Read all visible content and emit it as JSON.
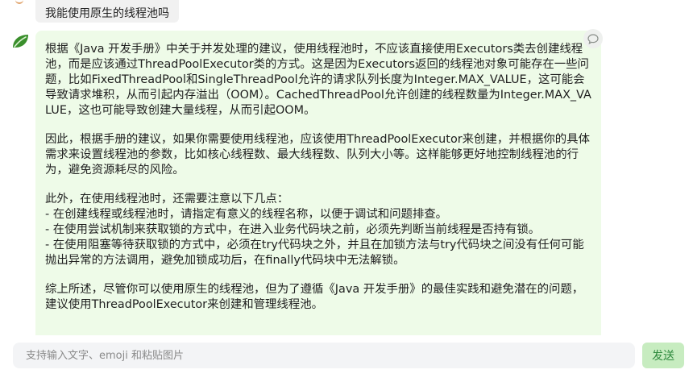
{
  "user_message": {
    "text": "我能使用原生的线程池吗"
  },
  "bot_message": {
    "paragraphs": [
      "根据《Java 开发手册》中关于并发处理的建议，使用线程池时，不应该直接使用Executors类去创建线程池，而是应该通过ThreadPoolExecutor类的方式。这是因为Executors返回的线程池对象可能存在一些问题，比如FixedThreadPool和SingleThreadPool允许的请求队列长度为Integer.MAX_VALUE，这可能会导致请求堆积，从而引起内存溢出（OOM）。CachedThreadPool允许创建的线程数量为Integer.MAX_VALUE，这也可能导致创建大量线程，从而引起OOM。",
      "因此，根据手册的建议，如果你需要使用线程池，应该使用ThreadPoolExecutor来创建，并根据你的具体需求来设置线程池的参数，比如核心线程数、最大线程数、队列大小等。这样能够更好地控制线程池的行为，避免资源耗尽的风险。"
    ],
    "list_intro": "此外，在使用线程池时，还需要注意以下几点：",
    "list_items": [
      "- 在创建线程或线程池时，请指定有意义的线程名称，以便于调试和问题排查。",
      "- 在使用尝试机制来获取锁的方式中，在进入业务代码块之前，必须先判断当前线程是否持有锁。",
      "- 在使用阻塞等待获取锁的方式中，必须在try代码块之外，并且在加锁方法与try代码块之间没有任何可能抛出异常的方法调用，避免加锁成功后，在finally代码块中无法解锁。"
    ],
    "conclusion": "综上所述，尽管你可以使用原生的线程池，但为了遵循《Java 开发手册》的最佳实践和避免潜在的问题，建议使用ThreadPoolExecutor来创建和管理线程池。"
  },
  "input": {
    "placeholder": "支持输入文字、emoji 和粘贴图片",
    "value": ""
  },
  "send_label": "发送",
  "colors": {
    "bot_bubble": "#eefbe8",
    "user_bubble": "#f1f1f1",
    "send_button_bg": "#c7ecc0",
    "send_button_text": "#2f8a3e",
    "avatar_leaf": "#3a8f2c"
  },
  "icons": {
    "bot_avatar": "leaf-icon",
    "bubble_tool": "comment-icon"
  }
}
